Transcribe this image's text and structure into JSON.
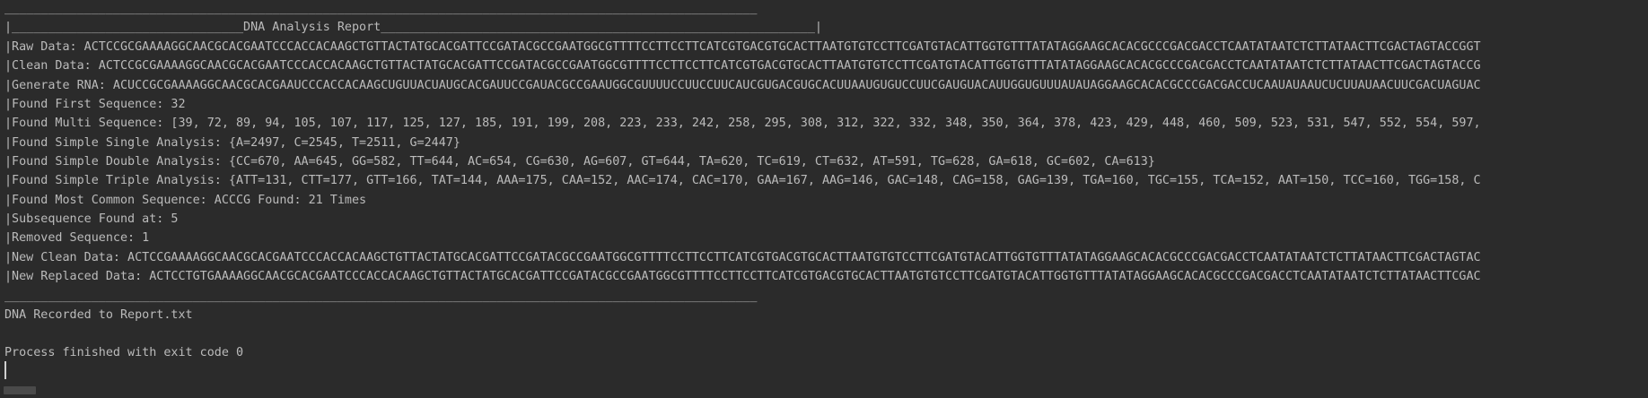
{
  "console": {
    "border_top": "________________________________________________________________________________________________________",
    "header": "|________________________________DNA Analysis Report____________________________________________________________|",
    "raw_data": "|Raw Data: ACTCCGCGAAAAGGCAACGCACGAATCCCACCACAAGCTGTTACTATGCACGATTCCGATACGCCGAATGGCGTTTTCCTTCCTTCATCGTGACGTGCACTTAATGTGTCCTTCGATGTACATTGGTGTTTATATAGGAAGCACACGCCCGACGACCTCAATATAATCTCTTATAACTTCGACTAGTACCGGT",
    "clean_data": "|Clean Data: ACTCCGCGAAAAGGCAACGCACGAATCCCACCACAAGCTGTTACTATGCACGATTCCGATACGCCGAATGGCGTTTTCCTTCCTTCATCGTGACGTGCACTTAATGTGTCCTTCGATGTACATTGGTGTTTATATAGGAAGCACACGCCCGACGACCTCAATATAATCTCTTATAACTTCGACTAGTACCG",
    "generate_rna": "|Generate RNA: ACUCCGCGAAAAGGCAACGCACGAAUCCCACCACAAGCUGUUACUAUGCACGAUUCCGAUACGCCGAAUGGCGUUUUCCUUCCUUCAUCGUGACGUGCACUUAAUGUGUCCUUCGAUGUACAUUGGUGUUUAUAUAGGAAGCACACGCCCGACGACCUCAAUAUAAUCUCUUAUAACUUCGACUAGUAC",
    "found_first": "|Found First Sequence: 32",
    "found_multi": "|Found Multi Sequence: [39, 72, 89, 94, 105, 107, 117, 125, 127, 185, 191, 199, 208, 223, 233, 242, 258, 295, 308, 312, 322, 332, 348, 350, 364, 378, 423, 429, 448, 460, 509, 523, 531, 547, 552, 554, 597,",
    "found_single": "|Found Simple Single Analysis: {A=2497, C=2545, T=2511, G=2447}",
    "found_double": "|Found Simple Double Analysis: {CC=670, AA=645, GG=582, TT=644, AC=654, CG=630, AG=607, GT=644, TA=620, TC=619, CT=632, AT=591, TG=628, GA=618, GC=602, CA=613}",
    "found_triple": "|Found Simple Triple Analysis: {ATT=131, CTT=177, GTT=166, TAT=144, AAA=175, CAA=152, AAC=174, CAC=170, GAA=167, AAG=146, GAC=148, CAG=158, GAG=139, TGA=160, TGC=155, TCA=152, AAT=150, TCC=160, TGG=158, C",
    "most_common": "|Found Most Common Sequence: ACCCG Found: 21 Times",
    "subsequence": "|Subsequence Found at: 5",
    "removed": "|Removed Sequence: 1",
    "new_clean": "|New Clean Data: ACTCCGAAAAGGCAACGCACGAATCCCACCACAAGCTGTTACTATGCACGATTCCGATACGCCGAATGGCGTTTTCCTTCCTTCATCGTGACGTGCACTTAATGTGTCCTTCGATGTACATTGGTGTTTATATAGGAAGCACACGCCCGACGACCTCAATATAATCTCTTATAACTTCGACTAGTAC",
    "new_replaced": "|New Replaced Data: ACTCCTGTGAAAAGGCAACGCACGAATCCCACCACAAGCTGTTACTATGCACGATTCCGATACGCCGAATGGCGTTTTCCTTCCTTCATCGTGACGTGCACTTAATGTGTCCTTCGATGTACATTGGTGTTTATATAGGAAGCACACGCCCGACGACCTCAATATAATCTCTTATAACTTCGAC",
    "border_bottom": "________________________________________________________________________________________________________",
    "recorded": "DNA Recorded to Report.txt",
    "exit": "Process finished with exit code 0"
  },
  "colors": {
    "background": "#2b2b2b",
    "text": "#bbbbbb"
  }
}
